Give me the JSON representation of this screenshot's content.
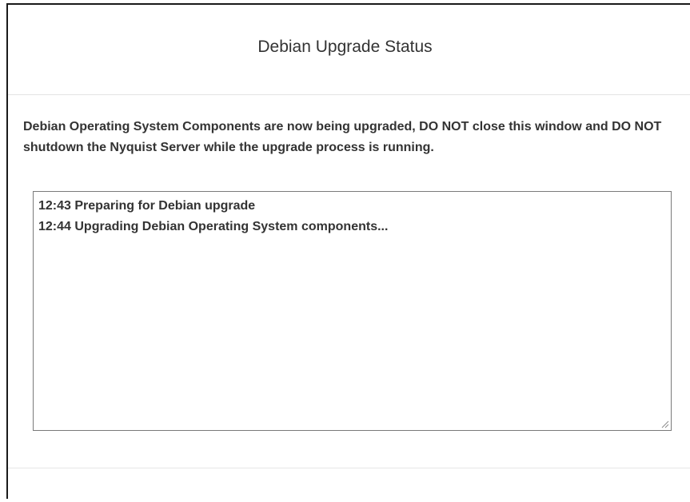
{
  "dialog": {
    "title": "Debian Upgrade Status",
    "message": "Debian Operating System Components are now being upgraded, DO NOT close this window and DO NOT shutdown the Nyquist Server while the upgrade process is running."
  },
  "log": {
    "lines": [
      "12:43 Preparing for Debian upgrade",
      "12:44 Upgrading Debian Operating System components..."
    ]
  },
  "icons": {
    "resize_grip": "resize-grip-icon"
  }
}
